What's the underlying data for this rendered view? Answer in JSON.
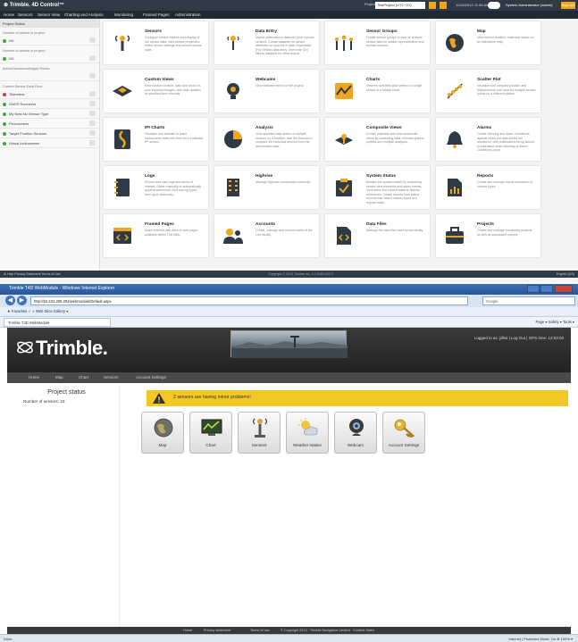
{
  "top": {
    "brand": "⊕ Trimble.  4D Control™",
    "nav": [
      "Home",
      "Sensors",
      "Sensor View",
      "Charting and Analysis",
      "Monitoring",
      "Framed Pages",
      "Administration"
    ],
    "project_label": "Project:",
    "project_value": "TestProject (UTC+01)",
    "datetime": "11/26/2013 11:58 AM",
    "user": "System Administrator (admin)",
    "signout": "Sign out",
    "sidebar": {
      "header": "Project Status",
      "sections": [
        {
          "label": "Number of alarms in project:",
          "value": "OK",
          "dot": "#3aa845"
        },
        {
          "label": "Number of alarms in project:",
          "value": "OK",
          "dot": "#3aa845"
        },
        {
          "label": "Active/Unacknowledged Points:",
          "value": "",
          "dot": ""
        },
        {
          "label": "Current Sensor Data Flow:",
          "value": "",
          "dot": ""
        }
      ],
      "items": [
        {
          "label": "Tiltmeters",
          "dot": "#d23b3b"
        },
        {
          "label": "GNSS Receivers",
          "dot": "#3aa845"
        },
        {
          "label": "My Nest No Sensor Type",
          "dot": "#3aa845"
        },
        {
          "label": "Piezometers",
          "dot": "#3aa845"
        },
        {
          "label": "Target Position Sensors",
          "dot": "#3aa845"
        },
        {
          "label": "Virtual Inclinometer",
          "dot": "#3aa845"
        }
      ]
    },
    "cards": [
      {
        "title": "Sensors",
        "desc": "Configure sensor objects and display of the sensor data; view sensor properties; select sensor settings and current sensor state.",
        "icon": "sensors-icon"
      },
      {
        "title": "Data Entry",
        "desc": "Import observations data into your manual sensors. Create datasets for sensor attributes on your MUX data. Exportable (For Offline) data entry. Overwrite (Or) files to datasets for other import.",
        "icon": "data-entry-icon"
      },
      {
        "title": "Sensor Groups",
        "desc": "Create sensor groups to view or analyze sensor data for similar representative and archive sensors.",
        "icon": "sensor-groups-icon"
      },
      {
        "title": "Map",
        "desc": "View sensor location, state and status on an interactive map.",
        "icon": "map-icon"
      },
      {
        "title": "Custom Views",
        "desc": "View custom content, data and views on your imported images, with data updates at specified time intervals.",
        "icon": "custom-views-icon"
      },
      {
        "title": "Webcams",
        "desc": "View webcam feeds for the project.",
        "icon": "webcam-icon"
      },
      {
        "title": "Charts",
        "desc": "View the selected data series of a single sensor in a simple chart.",
        "icon": "charts-icon"
      },
      {
        "title": "Scatter Plot",
        "desc": "Visualize and compare position and displacement over time for multiple sensor points on a different planes.",
        "icon": "scatter-plot-icon"
      },
      {
        "title": "IPI Charts",
        "desc": "Visualize and animate in place inclinometer data over time for a particular IPI sensor.",
        "icon": "ipi-charts-icon"
      },
      {
        "title": "Analysis",
        "desc": "View selected data series of multiple sensors on a timeline. Add the formula to compare the historical derived from the deformation data.",
        "icon": "analysis-icon"
      },
      {
        "title": "Composite Views",
        "desc": "Create, maintain and view composite views by combining data, relevant graphs, profiles and multiple analyses.",
        "icon": "composite-views-icon"
      },
      {
        "title": "Alarms",
        "desc": "Create Warning and Alarm Conditions against which the data series are monitored, with notifications being issued to interested when Warning or Alarm Conditions occur.",
        "icon": "alarms-icon"
      },
      {
        "title": "Logs",
        "desc": "Record and view logs and terms of interest. Either manually or automatically append comments. Add any log types from upon data entry.",
        "icon": "logs-icon"
      },
      {
        "title": "Highrise",
        "desc": "Manage Highrise construction networks.",
        "icon": "highrise-icon"
      },
      {
        "title": "System Status",
        "desc": "Monitor the system health by examining sensor data elements and alarm events. View either the current state or historic references. Create reports from status records that view a status report at a regular basis.",
        "icon": "system-status-icon"
      },
      {
        "title": "Reports",
        "desc": "Create and manage report schedules of various types.",
        "icon": "reports-icon"
      },
      {
        "title": "Framed Pages",
        "desc": "Make external web sites or web pages available within T4D Web.",
        "icon": "framed-pages-icon"
      },
      {
        "title": "Accounts",
        "desc": "Create, manage and remove users of the Live facility.",
        "icon": "accounts-icon"
      },
      {
        "title": "Data Files",
        "desc": "Manage the data files used by the facility.",
        "icon": "data-files-icon"
      },
      {
        "title": "Projects",
        "desc": "Create and manage monitoring projects as well as associated options.",
        "icon": "projects-icon"
      }
    ],
    "footer_left": "⊕ Help   Privacy Statement   Terms of Use",
    "footer_center": "Copyright © 2013  Trimble Inc.   4.2.2065.42177",
    "footer_right": "English (US)"
  },
  "bottom": {
    "window_title": "Trimble T4D WebModule - Windows Internet Explorer",
    "address": "http://62.234.206.202/webmodule/Default.aspx",
    "search_placeholder": "Google",
    "favorites": "★ Favorites   ☆  ◐ Web Slice Gallery ▾",
    "tab_label": "Trimble T4D WebModule",
    "commands": "Page ▾  Safety ▾  Tools ▾",
    "logo": "Trimble.",
    "logged_in": "Logged in as: jdhsi | Log Out | GPS time: 12:03:00",
    "nav": [
      "Home",
      "Map",
      "Chart",
      "Sensors",
      "Account Settings"
    ],
    "project_status": "Project status",
    "sensor_count": "Number of sensors: 23",
    "alert": "2 sensors are having minor problems!",
    "buttons": [
      {
        "label": "Map",
        "icon": "globe-icon"
      },
      {
        "label": "Chart",
        "icon": "chart-icon"
      },
      {
        "label": "Sensors",
        "icon": "sensor-icon"
      },
      {
        "label": "Weather station",
        "icon": "weather-icon"
      },
      {
        "label": "Webcam",
        "icon": "webcam-icon"
      },
      {
        "label": "Account Settings",
        "icon": "key-icon"
      }
    ],
    "footer": [
      "Home",
      "Privacy statement",
      "Terms of use",
      "© Copyright 2013 · Trimble Navigation Limited · Contact Sales"
    ],
    "status_left": "Done",
    "status_right": "Internet | Protected Mode: On    ⊕ 100% ▾"
  }
}
